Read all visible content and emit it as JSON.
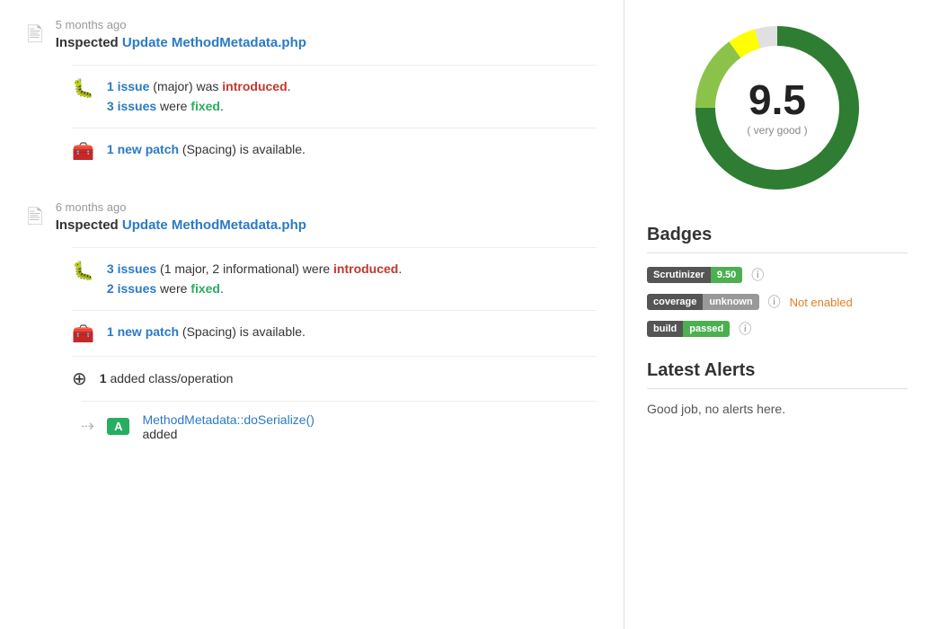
{
  "left": {
    "entries": [
      {
        "id": "entry-1",
        "timestamp": "5 months ago",
        "title_prefix": "Inspected",
        "title_link": "Update MethodMetadata.php",
        "details": [
          {
            "type": "issues",
            "icon": "bug",
            "lines": [
              {
                "prefix": "",
                "count_text": "1 issue",
                "middle": " (major) was ",
                "action": "introduced",
                "suffix": "."
              },
              {
                "prefix": "",
                "count_text": "3 issues",
                "middle": " were ",
                "action": "fixed",
                "suffix": "."
              }
            ]
          },
          {
            "type": "patch",
            "icon": "patch",
            "line": {
              "count_text": "1 new patch",
              "middle": " (Spacing) is available."
            }
          }
        ]
      },
      {
        "id": "entry-2",
        "timestamp": "6 months ago",
        "title_prefix": "Inspected",
        "title_link": "Update MethodMetadata.php",
        "details": [
          {
            "type": "issues",
            "icon": "bug",
            "lines": [
              {
                "prefix": "",
                "count_text": "3 issues",
                "middle": " (1 major, 2 informational) were ",
                "action": "introduced",
                "suffix": "."
              },
              {
                "prefix": "",
                "count_text": "2 issues",
                "middle": " were ",
                "action": "fixed",
                "suffix": "."
              }
            ]
          },
          {
            "type": "patch",
            "icon": "patch",
            "line": {
              "count_text": "1 new patch",
              "middle": " (Spacing) is available."
            }
          },
          {
            "type": "added",
            "icon": "plus",
            "line": {
              "count": "1",
              "text": " added class/operation"
            }
          }
        ],
        "method": {
          "badge": "A",
          "link_text": "MethodMetadata::doSerialize()",
          "action": "added"
        }
      }
    ]
  },
  "right": {
    "score": {
      "value": "9.5",
      "label": "( very good )"
    },
    "badges": {
      "section_title": "Badges",
      "scrutinizer": {
        "label": "Scrutinizer",
        "value": "9.50"
      },
      "coverage": {
        "label": "coverage",
        "value": "unknown",
        "not_enabled_text": "Not enabled"
      },
      "build": {
        "label": "build",
        "value": "passed"
      }
    },
    "alerts": {
      "section_title": "Latest Alerts",
      "text": "Good job, no alerts here."
    }
  }
}
